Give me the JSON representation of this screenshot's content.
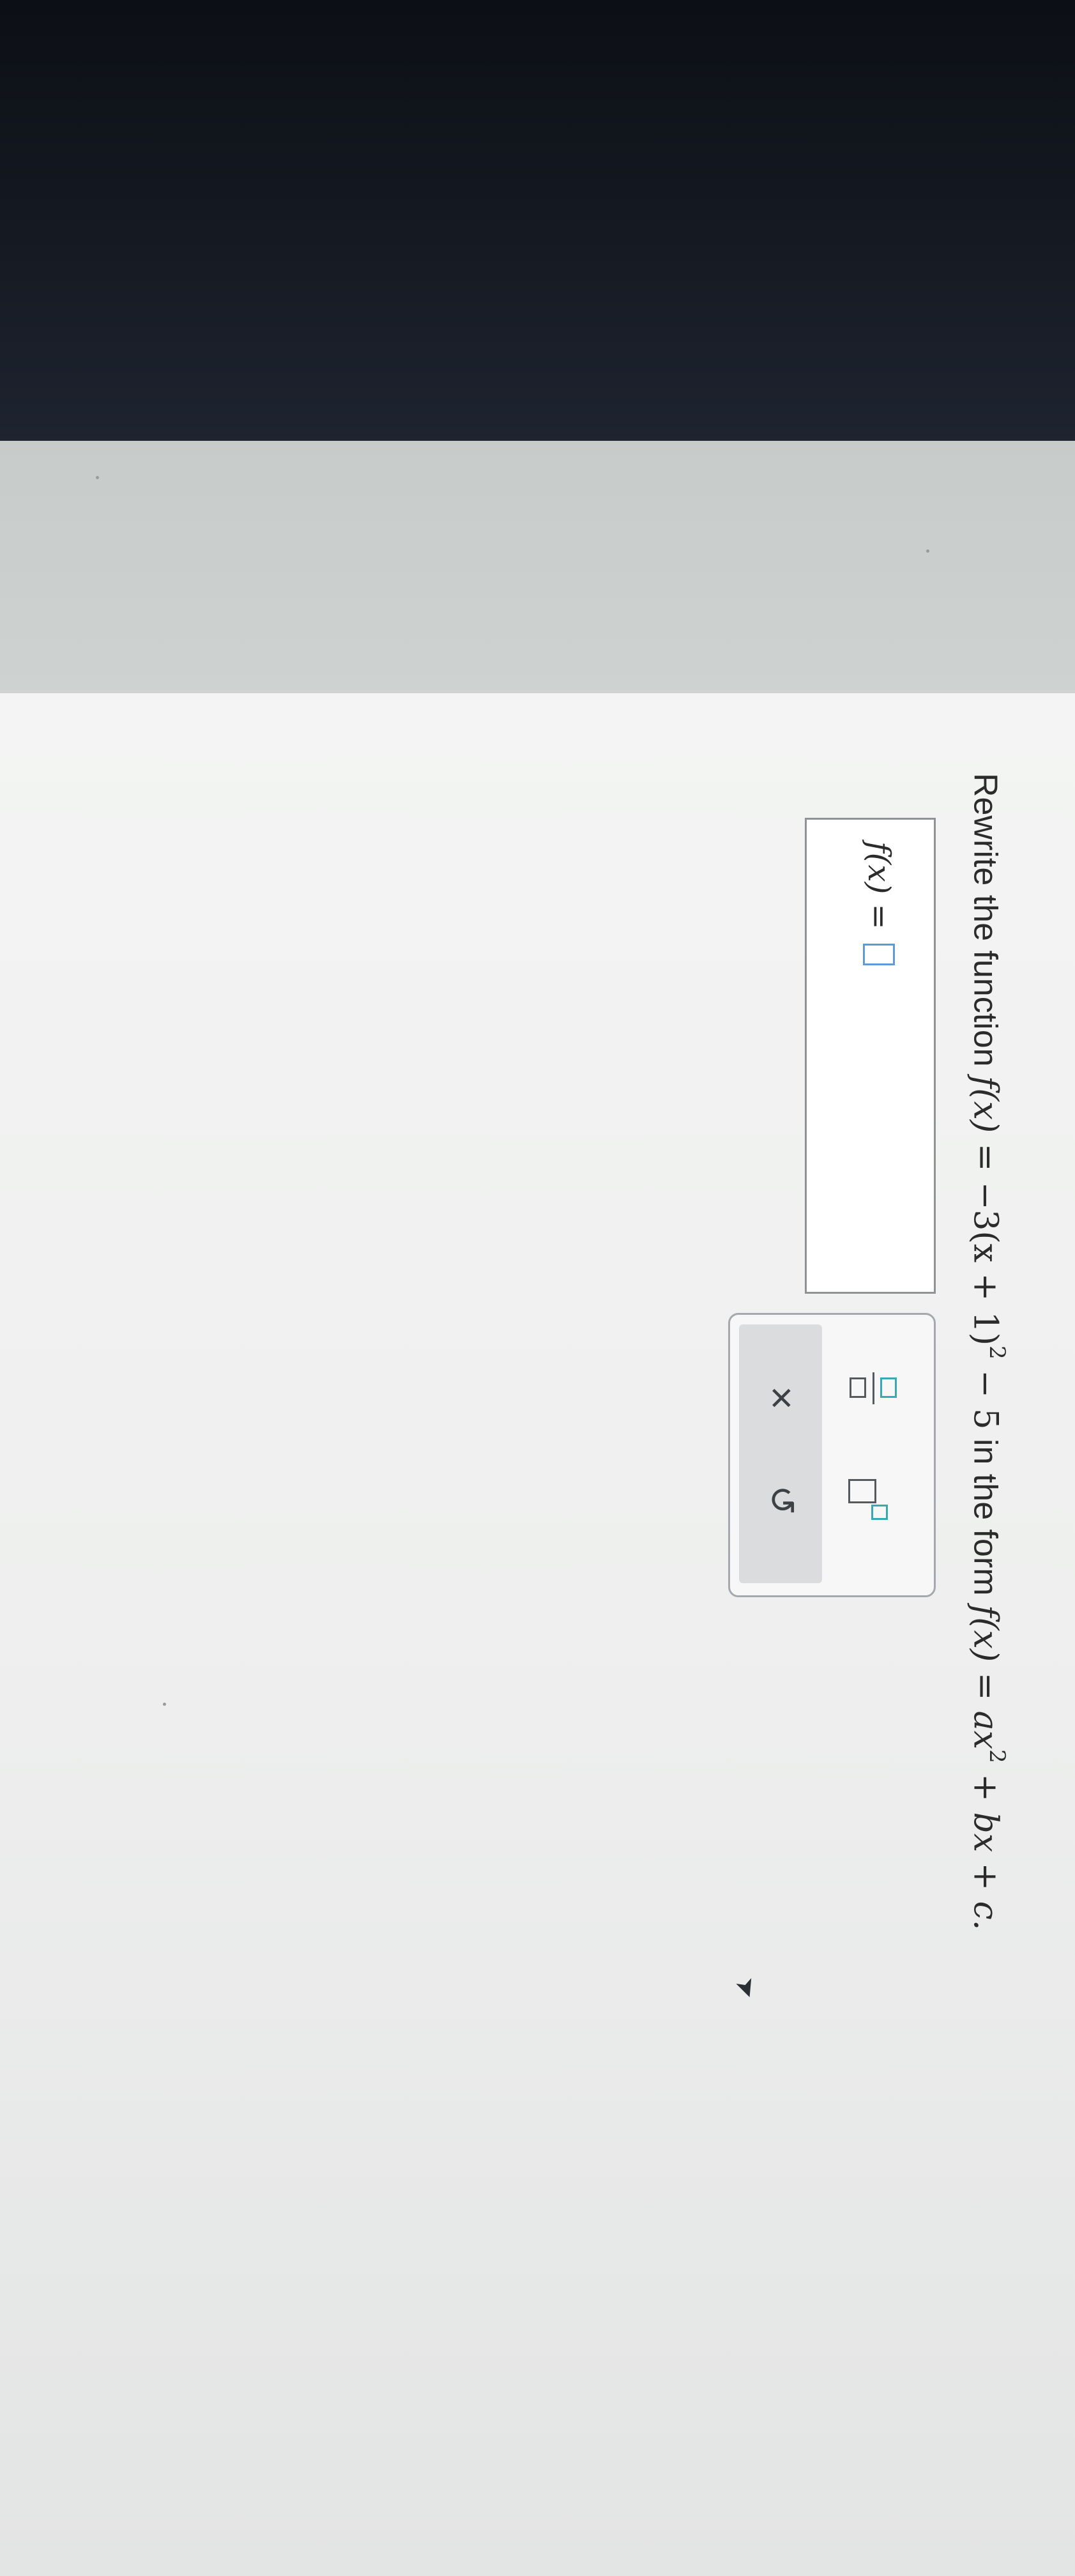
{
  "question": {
    "prefix": "Rewrite the function ",
    "given_lhs": "f(x)",
    "given_rhs_a": " = −3(x + 1)",
    "given_exp": "2",
    "given_rhs_b": " − 5",
    "middle": " in the form ",
    "form_lhs": "f(x)",
    "form_rhs_a": " = ax",
    "form_exp": "2",
    "form_rhs_b": " + bx + c."
  },
  "answer": {
    "label": "f(x) =",
    "value": ""
  },
  "toolbox": {
    "buttons": [
      {
        "name": "fraction",
        "icon": "fraction-icon"
      },
      {
        "name": "exponent",
        "icon": "superscript-icon"
      },
      {
        "name": "clear",
        "icon": "close-icon",
        "glyph": "×"
      },
      {
        "name": "undo",
        "icon": "undo-icon",
        "glyph": "↺"
      }
    ]
  },
  "colors": {
    "input_border": "#5d9bd6",
    "template_accent": "#3aa7b4",
    "text": "#2b2b2b"
  }
}
